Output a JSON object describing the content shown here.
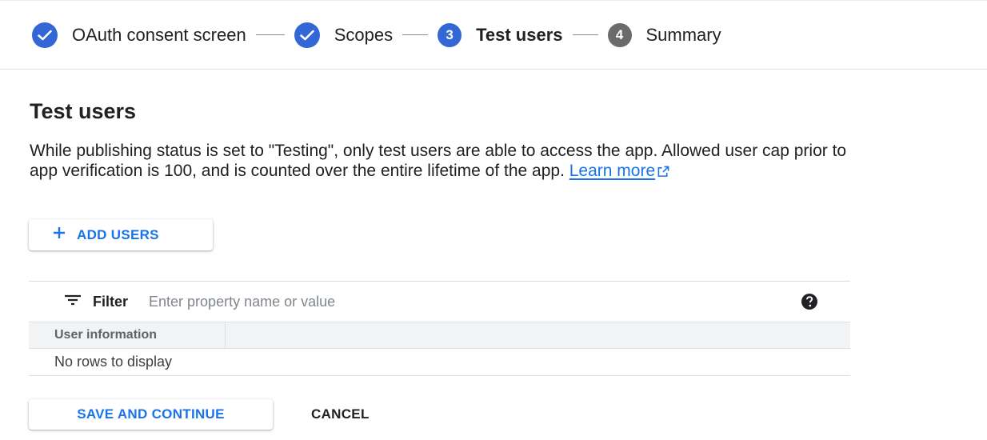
{
  "stepper": {
    "steps": [
      {
        "label": "OAuth consent screen",
        "state": "done"
      },
      {
        "label": "Scopes",
        "state": "done"
      },
      {
        "number": "3",
        "label": "Test users",
        "state": "current"
      },
      {
        "number": "4",
        "label": "Summary",
        "state": "pending"
      }
    ]
  },
  "page": {
    "title": "Test users",
    "description": "While publishing status is set to \"Testing\", only test users are able to access the app. Allowed user cap prior to app verification is 100, and is counted over the entire lifetime of the app. ",
    "learn_more": "Learn more"
  },
  "actions": {
    "add_users": "ADD USERS",
    "save_continue": "SAVE AND CONTINUE",
    "cancel": "CANCEL"
  },
  "table": {
    "filter_label": "Filter",
    "filter_placeholder": "Enter property name or value",
    "columns": [
      "User information"
    ],
    "empty_message": "No rows to display"
  },
  "icons": {
    "check": "check-icon",
    "external": "external-link-icon",
    "plus": "plus-icon",
    "filter": "filter-icon",
    "help": "help-icon"
  },
  "colors": {
    "primary": "#3367d6",
    "link": "#1a73e8",
    "pending_step": "#6b6b6b",
    "header_bg": "#f1f3f4"
  }
}
